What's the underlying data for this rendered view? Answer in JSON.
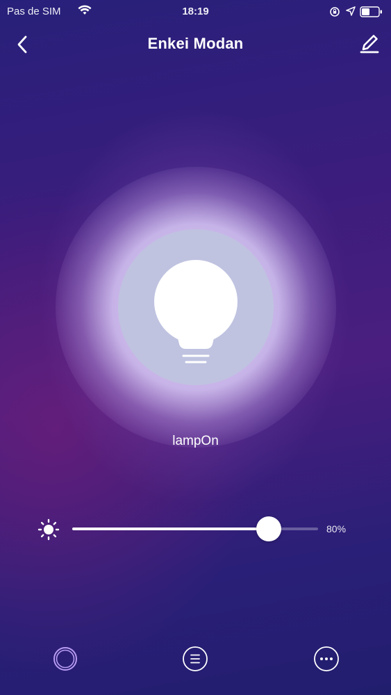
{
  "status_bar": {
    "carrier": "Pas de SIM",
    "time": "18:19",
    "icons": [
      "wifi-icon",
      "orientation-lock-icon",
      "location-icon",
      "battery-icon"
    ]
  },
  "nav": {
    "title": "Enkei Modan",
    "back_icon": "chevron-left-icon",
    "edit_icon": "pencil-icon"
  },
  "lamp": {
    "state_label": "lampOn",
    "icon": "lightbulb-icon",
    "glow_color": "#e6defa",
    "button_color": "#bfc3e0"
  },
  "brightness": {
    "value": 80,
    "value_label": "80%",
    "icon": "brightness-sun-icon"
  },
  "bottom_bar": {
    "items": [
      {
        "icon": "color-ring-icon",
        "active": true,
        "color": "#b89cf2"
      },
      {
        "icon": "list-icon",
        "active": false
      },
      {
        "icon": "more-icon",
        "active": false
      }
    ]
  }
}
